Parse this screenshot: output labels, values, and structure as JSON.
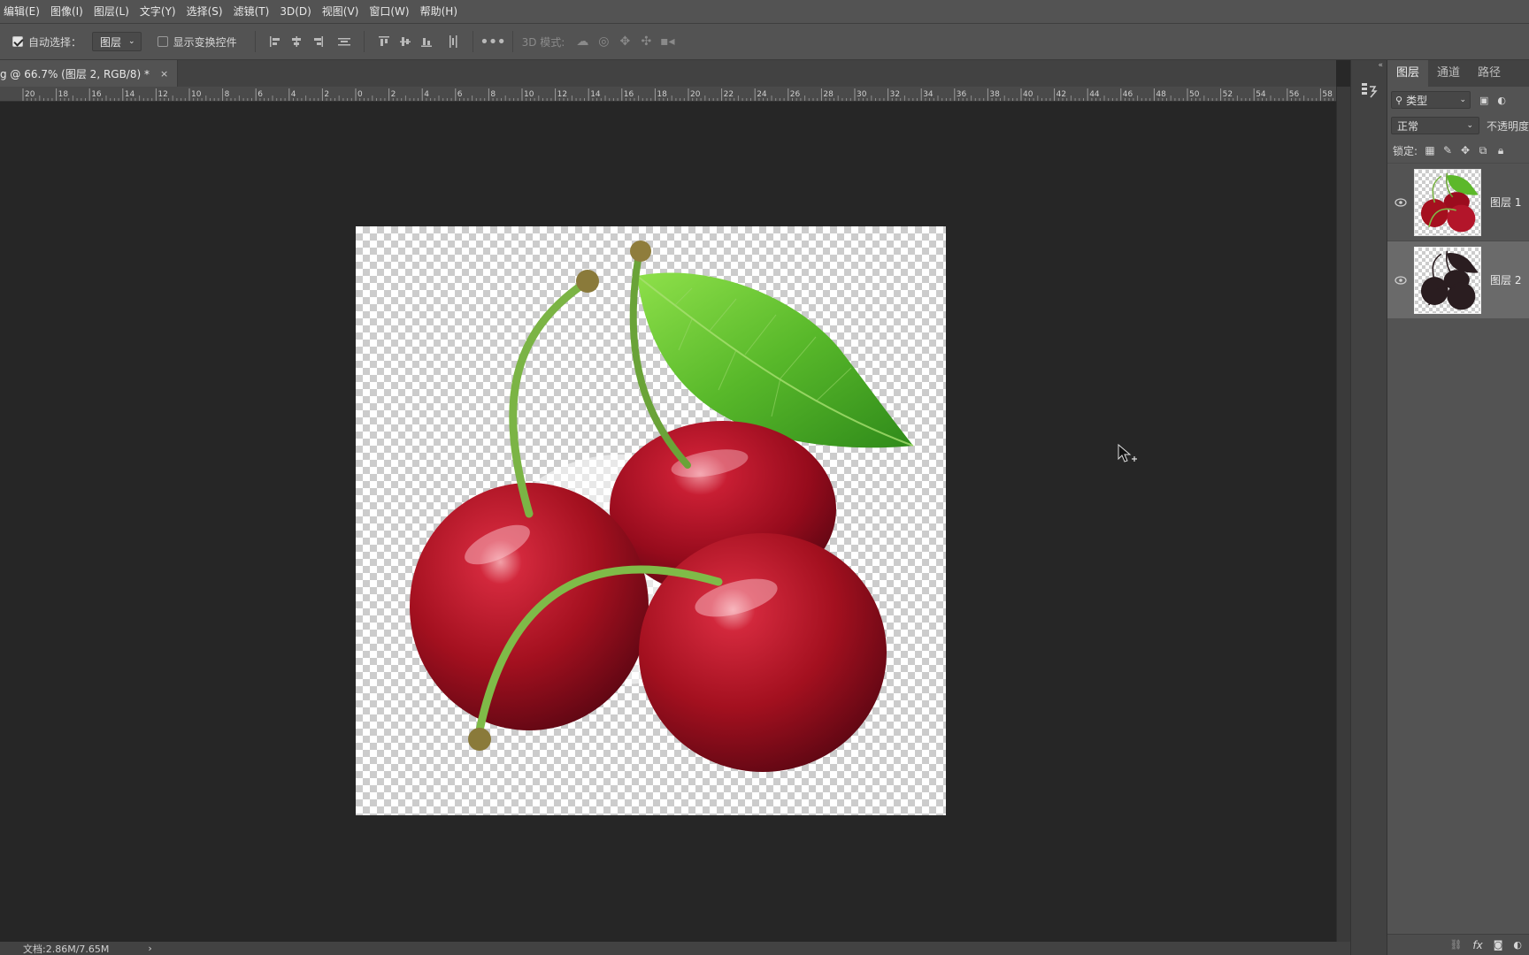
{
  "menu": {
    "items": [
      "编辑(E)",
      "图像(I)",
      "图层(L)",
      "文字(Y)",
      "选择(S)",
      "滤镜(T)",
      "3D(D)",
      "视图(V)",
      "窗口(W)",
      "帮助(H)"
    ]
  },
  "options": {
    "auto_select_label": "自动选择：",
    "auto_select_checked": true,
    "auto_select_target": "图层",
    "show_transform_label": "显示变换控件",
    "show_transform_checked": false,
    "three_d_mode_label": "3D 模式:"
  },
  "document_tab": {
    "title": "g @ 66.7% (图层 2, RGB/8) *",
    "close": "×"
  },
  "ruler": {
    "labels": [
      "20",
      "18",
      "16",
      "14",
      "12",
      "10",
      "8",
      "6",
      "4",
      "2",
      "0",
      "2",
      "4",
      "6",
      "8",
      "10",
      "12",
      "14",
      "16",
      "18",
      "20",
      "22",
      "24",
      "26",
      "28",
      "30",
      "32",
      "34",
      "36",
      "38",
      "40",
      "42",
      "44",
      "46",
      "48",
      "50",
      "52",
      "54",
      "56",
      "58"
    ]
  },
  "status": {
    "doc_size": "文档:2.86M/7.65M",
    "arrow": "›"
  },
  "layers_panel": {
    "tabs": [
      {
        "label": "图层",
        "active": true
      },
      {
        "label": "通道",
        "active": false
      },
      {
        "label": "路径",
        "active": false
      }
    ],
    "filter_label": "类型",
    "blend_mode": "正常",
    "opacity_label": "不透明度",
    "lock_label": "锁定:",
    "layers": [
      {
        "name": "图层 1",
        "visible": true,
        "selected": false,
        "thumb": "cherry-color"
      },
      {
        "name": "图层 2",
        "visible": true,
        "selected": true,
        "thumb": "cherry-silhouette"
      }
    ]
  },
  "colors": {
    "menubar": "#535353",
    "canvas_bg": "#262626",
    "cherry_red": "#9b0c1e",
    "leaf_green": "#5cb82a",
    "silhouette": "#2a1d20"
  }
}
